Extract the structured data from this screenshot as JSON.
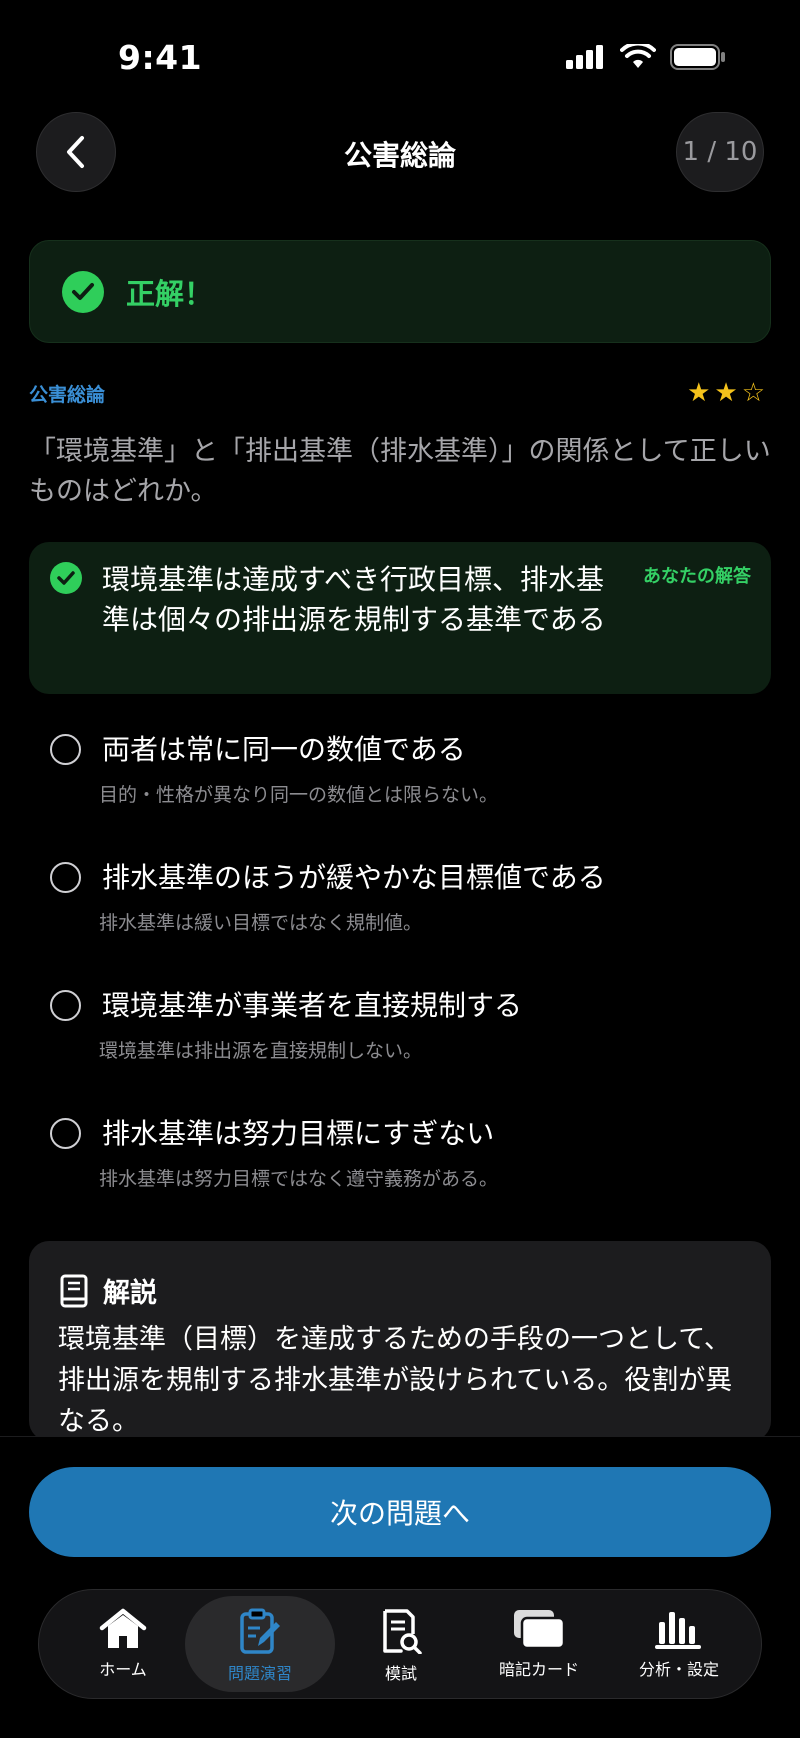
{
  "status_bar": {
    "time": "9:41"
  },
  "header": {
    "title": "公害総論",
    "counter": "1 / 10"
  },
  "result": {
    "label": "正解！"
  },
  "question": {
    "category": "公害総論",
    "difficulty_stars": 2,
    "difficulty_max": 3,
    "stars_display": "★★☆",
    "text": "「環境基準」と「排出基準（排水基準）」の関係として正しいものはどれか。"
  },
  "choices": [
    {
      "text": "環境基準は達成すべき行政目標、排水基準は個々の排出源を規制する基準である",
      "badge": "あなたの解答",
      "selected": true,
      "correct": true
    },
    {
      "text": "両者は常に同一の数値である",
      "note": "目的・性格が異なり同一の数値とは限らない。"
    },
    {
      "text": "排水基準のほうが緩やかな目標値である",
      "note": "排水基準は緩い目標ではなく規制値。"
    },
    {
      "text": "環境基準が事業者を直接規制する",
      "note": "環境基準は排出源を直接規制しない。"
    },
    {
      "text": "排水基準は努力目標にすぎない",
      "note": "排水基準は努力目標ではなく遵守義務がある。"
    }
  ],
  "explanation": {
    "title": "解説",
    "body": "環境基準（目標）を達成するための手段の一つとして、排出源を規制する排水基準が設けられている。役割が異なる。"
  },
  "next_button": {
    "label": "次の問題へ"
  },
  "tabs": [
    {
      "label": "ホーム",
      "icon": "home-icon"
    },
    {
      "label": "問題演習",
      "icon": "clipboard-edit-icon",
      "active": true
    },
    {
      "label": "模試",
      "icon": "document-search-icon"
    },
    {
      "label": "暗記カード",
      "icon": "cards-icon"
    },
    {
      "label": "分析・設定",
      "icon": "bar-chart-icon"
    }
  ],
  "colors": {
    "accent_green": "#2fce5a",
    "accent_blue": "#1f77b4",
    "tab_active": "#2f86c8"
  }
}
